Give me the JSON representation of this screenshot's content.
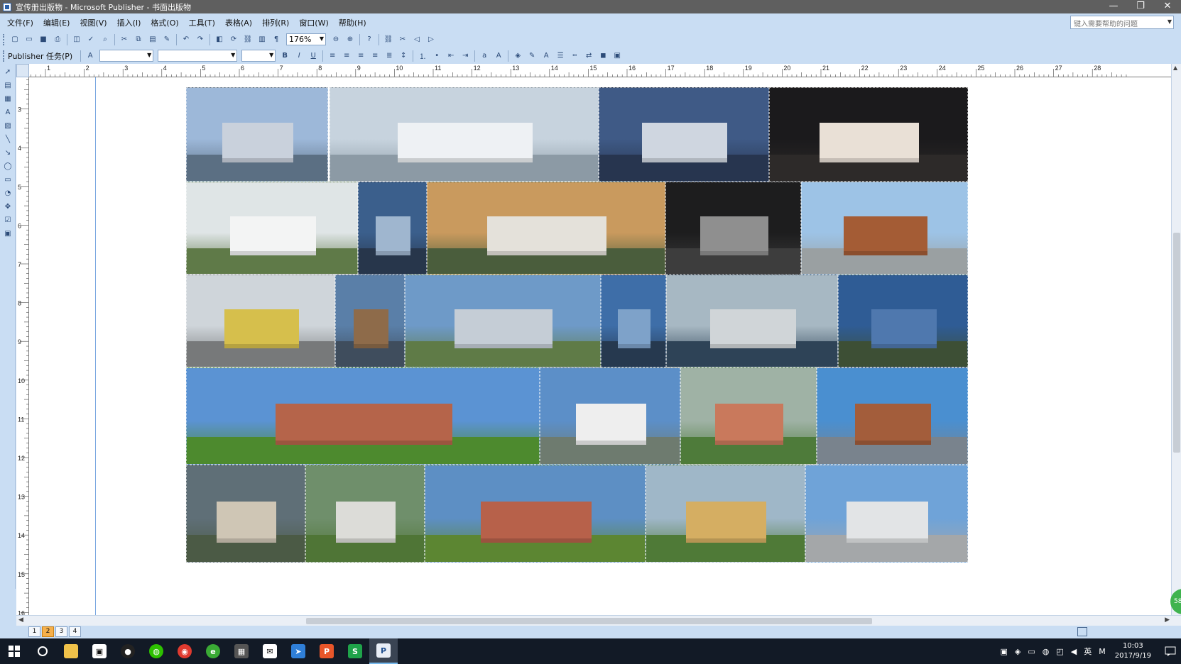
{
  "window": {
    "title": "宣传册出版物 - Microsoft Publisher - 书面出版物",
    "controls": [
      "—",
      "❐",
      "✕"
    ]
  },
  "menu": {
    "items": [
      "文件(F)",
      "编辑(E)",
      "视图(V)",
      "插入(I)",
      "格式(O)",
      "工具(T)",
      "表格(A)",
      "排列(R)",
      "窗口(W)",
      "帮助(H)"
    ],
    "help_placeholder": "键入需要帮助的问题"
  },
  "toolbar": {
    "zoom": "176%",
    "task_pane_label": "Publisher 任务(P)",
    "format_buttons": [
      "B",
      "I",
      "U"
    ]
  },
  "ruler": {
    "h_ticks": [
      "1",
      "2",
      "3",
      "4",
      "5",
      "6",
      "7",
      "8",
      "9",
      "10",
      "11",
      "12",
      "13",
      "14",
      "15",
      "16",
      "17",
      "18",
      "19",
      "20",
      "21",
      "22",
      "23",
      "24",
      "25",
      "26",
      "27",
      "28"
    ],
    "v_ticks": [
      "3",
      "4",
      "5",
      "6",
      "7",
      "8",
      "9",
      "10",
      "11",
      "12",
      "13",
      "14",
      "15",
      "16"
    ]
  },
  "document": {
    "images": [
      {
        "name": "twin-tower-waterfront",
        "bg": "#9db8d9",
        "ground": "#5b6f83",
        "bld": "#c9d1dc"
      },
      {
        "name": "curved-roof-plaza",
        "bg": "#c7d3de",
        "ground": "#8c9aa5",
        "bld": "#eef1f4"
      },
      {
        "name": "waterfront-hall-dusk",
        "bg": "#3f5a86",
        "ground": "#27354f",
        "bld": "#cfd6e0"
      },
      {
        "name": "night-glass-tower",
        "bg": "#1b1a1c",
        "ground": "#2d2a29",
        "bld": "#e9e0d6"
      },
      {
        "name": "angular-white-museum",
        "bg": "#dfe5e6",
        "ground": "#5f7a48",
        "bld": "#f3f4f4"
      },
      {
        "name": "blue-skyscraper",
        "bg": "#3b5f8c",
        "ground": "#27364b",
        "bld": "#9fb6cf"
      },
      {
        "name": "aerial-campus-sunset",
        "bg": "#c99a5e",
        "ground": "#4a5d3c",
        "bld": "#e4e1da"
      },
      {
        "name": "dark-concrete-interior",
        "bg": "#1d1d1e",
        "ground": "#3d3d3d",
        "bld": "#8f8f8f"
      },
      {
        "name": "round-brown-building",
        "bg": "#9dc3e6",
        "ground": "#9aa0a2",
        "bld": "#a45c35"
      },
      {
        "name": "yellow-cube-building",
        "bg": "#cfd5da",
        "ground": "#77797a",
        "bld": "#d6bf4c"
      },
      {
        "name": "brown-tower-pair",
        "bg": "#5a7fa8",
        "ground": "#3f4d5d",
        "bld": "#8e6b4a"
      },
      {
        "name": "glass-office-block",
        "bg": "#6e9ac8",
        "ground": "#5f7b47",
        "bld": "#c5cdd6"
      },
      {
        "name": "blue-office-towers",
        "bg": "#3e6ea8",
        "ground": "#26394f",
        "bld": "#7ea2c9"
      },
      {
        "name": "lakeside-hall",
        "bg": "#a7b8c3",
        "ground": "#2e4357",
        "bld": "#d0d5d8"
      },
      {
        "name": "blue-glass-highrise",
        "bg": "#2f5c95",
        "ground": "#3d4f35",
        "bld": "#4f78ae"
      },
      {
        "name": "red-brick-campus",
        "bg": "#5b93d3",
        "ground": "#4d8a2e",
        "bld": "#b5644a"
      },
      {
        "name": "white-modern-school",
        "bg": "#5c8fc8",
        "ground": "#6e7b6f",
        "bld": "#eeeeee"
      },
      {
        "name": "aerial-colorful-school",
        "bg": "#9fb2a5",
        "ground": "#4e7b3a",
        "bld": "#c9795c"
      },
      {
        "name": "brick-school-trees",
        "bg": "#4a8fd0",
        "ground": "#79838d",
        "bld": "#a35d3b"
      },
      {
        "name": "aerial-city-dusk",
        "bg": "#5f6f77",
        "ground": "#4b5a45",
        "bld": "#cfc6b5"
      },
      {
        "name": "aerial-green-campus",
        "bg": "#6f8f6b",
        "ground": "#4f7536",
        "bld": "#dcdcd8"
      },
      {
        "name": "lawn-red-school",
        "bg": "#5d8fc4",
        "ground": "#5c8632",
        "bld": "#b7614a"
      },
      {
        "name": "aerial-sports-field",
        "bg": "#9fb7c8",
        "ground": "#4f7a37",
        "bld": "#d5ae62"
      },
      {
        "name": "plaza-white-campus",
        "bg": "#6fa3d8",
        "ground": "#a4a7a9",
        "bld": "#e2e4e6"
      }
    ]
  },
  "pages": {
    "tabs": [
      "1",
      "2",
      "3",
      "4"
    ],
    "active": "2"
  },
  "status": {
    "badge": "58"
  },
  "taskbar": {
    "time": "10:03",
    "date": "2017/9/19",
    "ime": "英"
  }
}
